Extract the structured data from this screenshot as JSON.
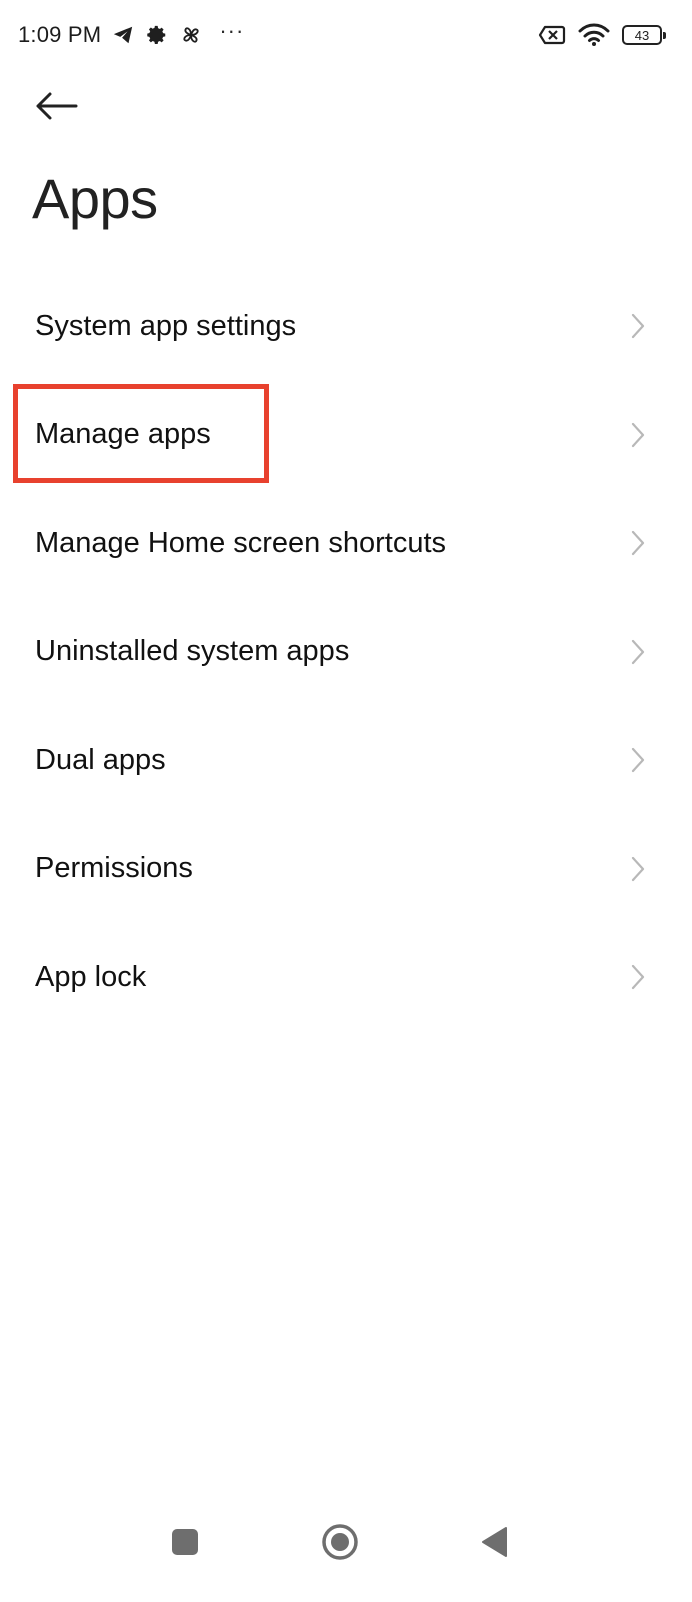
{
  "status_bar": {
    "time": "1:09 PM",
    "left_icons": [
      "telegram-icon",
      "gear-icon",
      "pinwheel-icon"
    ],
    "overflow": "···",
    "right_icons": [
      "sim-error-icon",
      "wifi-icon"
    ],
    "battery_level": "43"
  },
  "header": {
    "back_icon": "arrow-left-icon",
    "title": "Apps"
  },
  "menu": {
    "items": [
      {
        "label": "System app settings"
      },
      {
        "label": "Manage apps",
        "highlighted": true
      },
      {
        "label": "Manage Home screen shortcuts"
      },
      {
        "label": "Uninstalled system apps"
      },
      {
        "label": "Dual apps"
      },
      {
        "label": "Permissions"
      },
      {
        "label": "App lock"
      }
    ]
  },
  "nav_bar": {
    "buttons": [
      "recents-icon",
      "home-icon",
      "back-icon"
    ]
  },
  "colors": {
    "highlight": "#e8412e",
    "chevron": "#b8b8b8",
    "text": "#111111"
  }
}
